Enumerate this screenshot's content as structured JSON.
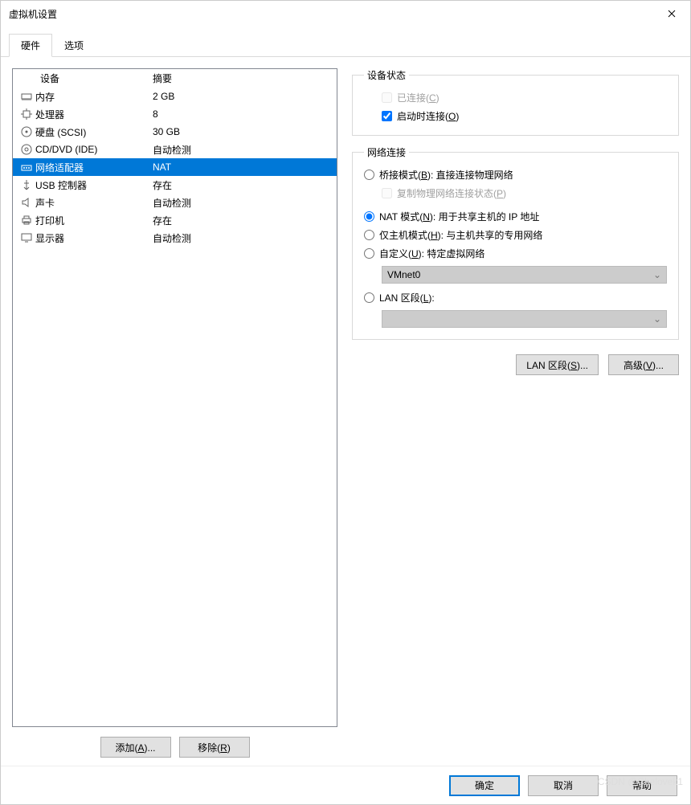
{
  "window": {
    "title": "虚拟机设置"
  },
  "tabs": {
    "hardware": "硬件",
    "options": "选项"
  },
  "headers": {
    "device": "设备",
    "summary": "摘要"
  },
  "devices": [
    {
      "icon": "memory-icon",
      "label": "内存",
      "summary": "2 GB"
    },
    {
      "icon": "cpu-icon",
      "label": "处理器",
      "summary": "8"
    },
    {
      "icon": "disk-icon",
      "label": "硬盘 (SCSI)",
      "summary": "30 GB"
    },
    {
      "icon": "cd-icon",
      "label": "CD/DVD (IDE)",
      "summary": "自动检测"
    },
    {
      "icon": "network-icon",
      "label": "网络适配器",
      "summary": "NAT",
      "selected": true
    },
    {
      "icon": "usb-icon",
      "label": "USB 控制器",
      "summary": "存在"
    },
    {
      "icon": "sound-icon",
      "label": "声卡",
      "summary": "自动检测"
    },
    {
      "icon": "printer-icon",
      "label": "打印机",
      "summary": "存在"
    },
    {
      "icon": "display-icon",
      "label": "显示器",
      "summary": "自动检测"
    }
  ],
  "left_buttons": {
    "add": "添加(A)...",
    "remove": "移除(R)"
  },
  "status_group": {
    "legend": "设备状态",
    "connected": "已连接(C)",
    "connect_poweron": "启动时连接(O)"
  },
  "network_group": {
    "legend": "网络连接",
    "bridged": "桥接模式(B): 直接连接物理网络",
    "replicate": "复制物理网络连接状态(P)",
    "nat": "NAT 模式(N): 用于共享主机的 IP 地址",
    "hostonly": "仅主机模式(H): 与主机共享的专用网络",
    "custom": "自定义(U): 特定虚拟网络",
    "custom_value": "VMnet0",
    "lanseg": "LAN 区段(L):"
  },
  "right_buttons": {
    "lanseg": "LAN 区段(S)...",
    "advanced": "高级(V)..."
  },
  "footer": {
    "ok": "确定",
    "cancel": "取消",
    "help": "帮助"
  },
  "watermark": "CSDN @Chelovek1"
}
